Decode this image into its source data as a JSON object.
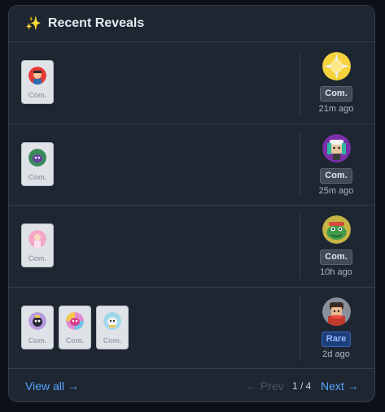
{
  "header": {
    "icon": "sparkles-icon",
    "title": "Recent Reveals"
  },
  "reveals": [
    {
      "cards": [
        {
          "rarity": "Com.",
          "thumb_color": "#e53935"
        }
      ],
      "avatar_color": "#f5d33c",
      "rarity": "Com.",
      "time": "21m ago"
    },
    {
      "cards": [
        {
          "rarity": "Com.",
          "thumb_color": "#3a8a5c"
        }
      ],
      "avatar_color": "#7b2fa8",
      "rarity": "Com.",
      "time": "25m ago"
    },
    {
      "cards": [
        {
          "rarity": "Com.",
          "thumb_color": "#f4a7c6"
        }
      ],
      "avatar_color": "#c6b545",
      "rarity": "Com.",
      "time": "10h ago"
    },
    {
      "cards": [
        {
          "rarity": "Com.",
          "thumb_color": "#b99be0"
        },
        {
          "rarity": "Com.",
          "thumb_color": "#e08bd0"
        },
        {
          "rarity": "Com.",
          "thumb_color": "#9fd8ea"
        }
      ],
      "avatar_color": "#b33a2a",
      "rarity": "Rare",
      "time": "2d ago"
    }
  ],
  "footer": {
    "view_all": "View all →",
    "prev": "← Prev",
    "page": "1 / 4",
    "next": "Next →"
  },
  "colors": {
    "accent": "#58a6ff",
    "panel": "#1e2631",
    "rare": "#8fb9ff"
  }
}
